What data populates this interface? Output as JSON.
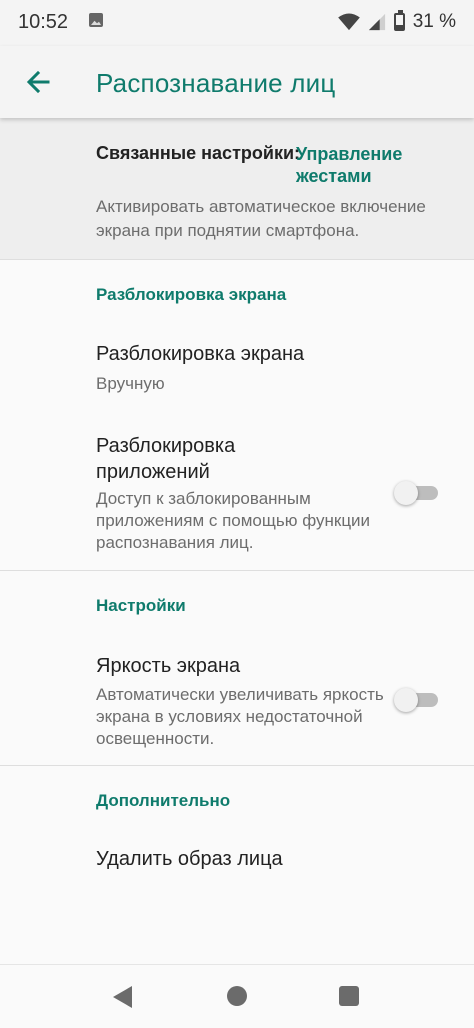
{
  "status_bar": {
    "time": "10:52",
    "battery": "31 %"
  },
  "app_bar": {
    "title": "Распознавание лиц"
  },
  "related": {
    "label": "Связанные настройки:",
    "link": "Управление жестами",
    "description": "Активировать автоматическое включение экрана при поднятии смартфона."
  },
  "sections": {
    "unlock": {
      "title": "Разблокировка экрана",
      "screen_unlock": {
        "title": "Разблокировка экрана",
        "value": "Вручную"
      },
      "app_unlock": {
        "title": "Разблокировка приложений",
        "description": "Доступ к заблокированным приложениям с помощью функции распознавания лиц.",
        "enabled": false
      }
    },
    "settings": {
      "title": "Настройки",
      "brightness": {
        "title": "Яркость экрана",
        "description": "Автоматически увеличивать яркость экрана в условиях недостаточной освещенности.",
        "enabled": false
      }
    },
    "advanced": {
      "title": "Дополнительно",
      "delete_face": {
        "title": "Удалить образ лица"
      }
    }
  },
  "colors": {
    "accent": "#0f7b6c",
    "background": "#fafafa",
    "related_background": "#eeeeee"
  },
  "icons": {
    "back": "arrow-left-icon",
    "nav_back": "triangle-back-icon",
    "nav_home": "circle-home-icon",
    "nav_recent": "square-recents-icon"
  }
}
